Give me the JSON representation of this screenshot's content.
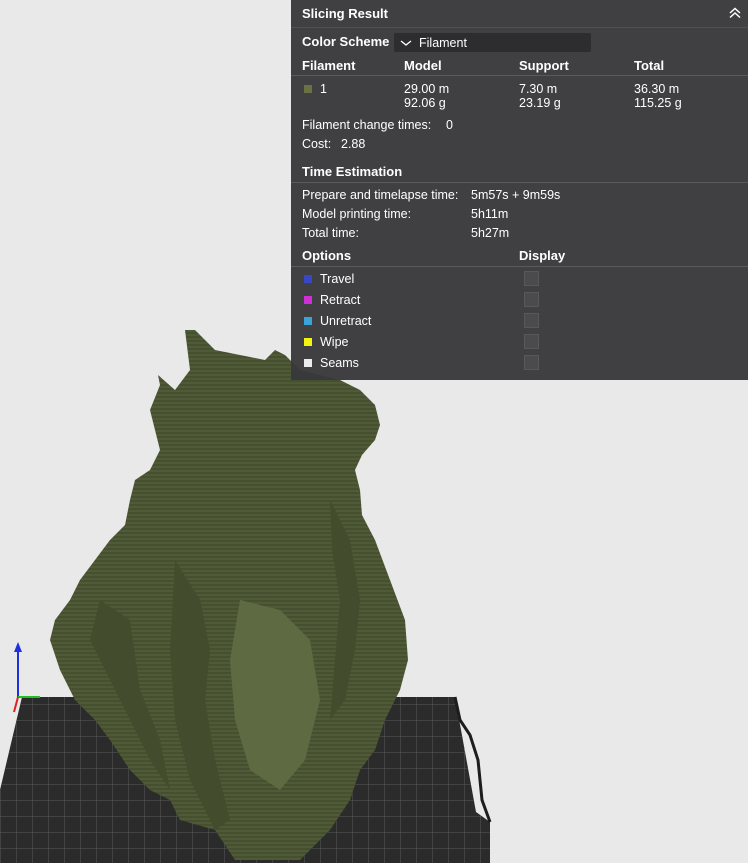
{
  "panel": {
    "title": "Slicing Result",
    "color_scheme_label": "Color Scheme",
    "color_scheme_value": "Filament",
    "headers": {
      "filament": "Filament",
      "model": "Model",
      "support": "Support",
      "total": "Total"
    },
    "filament_row": {
      "id": "1",
      "swatch_color": "#6b7142",
      "model_len": "29.00 m",
      "model_wt": "92.06 g",
      "support_len": "7.30 m",
      "support_wt": "23.19 g",
      "total_len": "36.30 m",
      "total_wt": "115.25 g"
    },
    "filament_change_label": "Filament change times:",
    "filament_change_value": "0",
    "cost_label": "Cost:",
    "cost_value": "2.88",
    "time_estimation_title": "Time Estimation",
    "time": {
      "prepare_label": "Prepare and timelapse time:",
      "prepare_value": "5m57s + 9m59s",
      "model_label": "Model printing time:",
      "model_value": "5h11m",
      "total_label": "Total time:",
      "total_value": "5h27m"
    },
    "options_header": "Options",
    "display_header": "Display",
    "options": [
      {
        "label": "Travel",
        "color": "#3846c8"
      },
      {
        "label": "Retract",
        "color": "#cf2fd6"
      },
      {
        "label": "Unretract",
        "color": "#3aa4d8"
      },
      {
        "label": "Wipe",
        "color": "#f4f413"
      },
      {
        "label": "Seams",
        "color": "#ececec"
      }
    ]
  },
  "scene": {
    "model_color": "#4f5a37",
    "plate_color": "#2b2b2b",
    "axis_colors": {
      "x": "#e02020",
      "y": "#20c020",
      "z": "#2030e0"
    }
  }
}
